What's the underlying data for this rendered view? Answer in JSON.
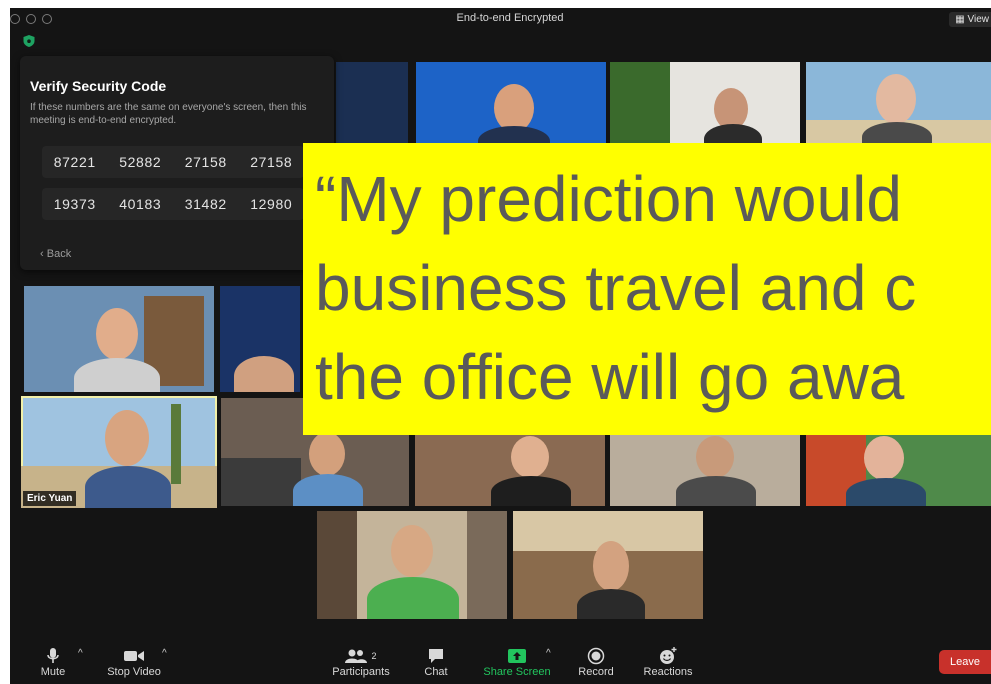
{
  "window": {
    "title": "End-to-end Encrypted",
    "view_button": "View"
  },
  "verify_panel": {
    "title": "Verify Security Code",
    "description": "If these numbers are the same on everyone's screen, then this meeting is end-to-end encrypted.",
    "codes_row1": [
      "87221",
      "52882",
      "27158",
      "27158"
    ],
    "codes_row2": [
      "19373",
      "40183",
      "31482",
      "12980"
    ],
    "back_label": "Back"
  },
  "participants": {
    "active_speaker_name": "Eric Yuan"
  },
  "banner": {
    "line1": "“My prediction would",
    "line2": "business travel and c",
    "line3": "the office will go awa"
  },
  "toolbar": {
    "mute": "Mute",
    "stop_video": "Stop Video",
    "participants": "Participants",
    "participants_count": "2",
    "chat": "Chat",
    "share_screen": "Share Screen",
    "record": "Record",
    "reactions": "Reactions",
    "leave": "Leave"
  },
  "colors": {
    "window_bg": "#141414",
    "banner_bg": "#ffff00",
    "banner_text": "#5a5a5a",
    "share_green": "#22c55e",
    "leave_red": "#c8312b",
    "active_speaker_border": "#f2f0a8"
  },
  "icons": {
    "shield": "shield-icon",
    "mic": "microphone-icon",
    "video": "video-camera-icon",
    "participants": "people-icon",
    "chat": "chat-bubble-icon",
    "share": "share-screen-icon",
    "record": "record-icon",
    "reactions": "emoji-icon"
  }
}
